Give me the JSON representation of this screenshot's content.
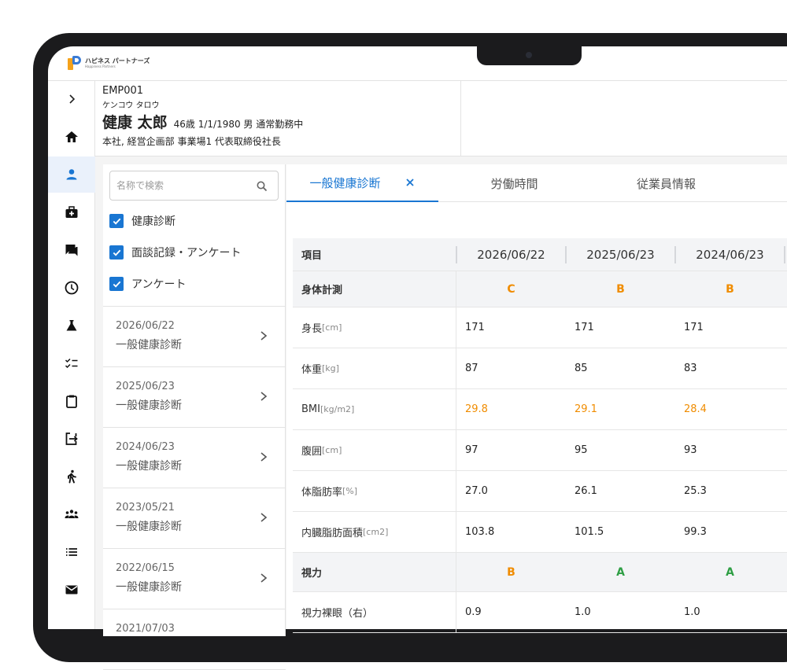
{
  "app": {
    "logo_main": "ハピネス パートナーズ",
    "logo_sub": "Happiness Partners"
  },
  "employee": {
    "id": "EMP001",
    "kana": "ケンコウ タロウ",
    "name": "健康 太郎",
    "meta": "46歳  1/1/1980  男  通常勤務中",
    "org": "本社, 経営企画部  事業場1  代表取締役社長"
  },
  "rail_icons": [
    "expand-chevron-icon",
    "home-icon",
    "person-icon",
    "medical-kit-icon",
    "chat-icon",
    "clock-icon",
    "flask-icon",
    "checklist-icon",
    "clipboard-icon",
    "export-icon",
    "walking-icon",
    "group-icon",
    "list-icon",
    "mail-icon"
  ],
  "search": {
    "placeholder": "名称で検索"
  },
  "filters": [
    {
      "label": "健康診断",
      "checked": true
    },
    {
      "label": "面談記録・アンケート",
      "checked": true
    },
    {
      "label": "アンケート",
      "checked": true
    }
  ],
  "records": [
    {
      "date": "2026/06/22",
      "type": "一般健康診断"
    },
    {
      "date": "2025/06/23",
      "type": "一般健康診断"
    },
    {
      "date": "2024/06/23",
      "type": "一般健康診断"
    },
    {
      "date": "2023/05/21",
      "type": "一般健康診断"
    },
    {
      "date": "2022/06/15",
      "type": "一般健康診断"
    },
    {
      "date": "2021/07/03",
      "type": ""
    }
  ],
  "tabs": [
    {
      "label": "一般健康診断",
      "active": true
    },
    {
      "label": "労働時間",
      "active": false
    },
    {
      "label": "従業員情報",
      "active": false
    }
  ],
  "table": {
    "header": {
      "item": "項目",
      "dates": [
        "2026/06/22",
        "2025/06/23",
        "2024/06/23"
      ]
    },
    "rows": [
      {
        "kind": "section",
        "label": "身体計測",
        "values": [
          "C",
          "B",
          "B"
        ]
      },
      {
        "kind": "data",
        "label": "身長",
        "unit": "[cm]",
        "values": [
          "171",
          "171",
          "171"
        ]
      },
      {
        "kind": "data",
        "label": "体重",
        "unit": "[kg]",
        "values": [
          "87",
          "85",
          "83"
        ]
      },
      {
        "kind": "data",
        "label": "BMI",
        "unit": "[kg/m2]",
        "values": [
          "29.8",
          "29.1",
          "28.4"
        ],
        "highlight": true
      },
      {
        "kind": "data",
        "label": "腹囲",
        "unit": "[cm]",
        "values": [
          "97",
          "95",
          "93"
        ]
      },
      {
        "kind": "data",
        "label": "体脂肪率",
        "unit": "[%]",
        "values": [
          "27.0",
          "26.1",
          "25.3"
        ]
      },
      {
        "kind": "data",
        "label": "内臓脂肪面積",
        "unit": "[cm2]",
        "values": [
          "103.8",
          "101.5",
          "99.3"
        ]
      },
      {
        "kind": "section",
        "label": "視力",
        "values": [
          "B",
          "A",
          "A"
        ]
      },
      {
        "kind": "data",
        "label": "視力裸眼（右）",
        "unit": "",
        "values": [
          "0.9",
          "1.0",
          "1.0"
        ]
      }
    ]
  },
  "colors": {
    "accent": "#1976d2",
    "warning": "#f08c00",
    "good": "#2e9e44"
  }
}
